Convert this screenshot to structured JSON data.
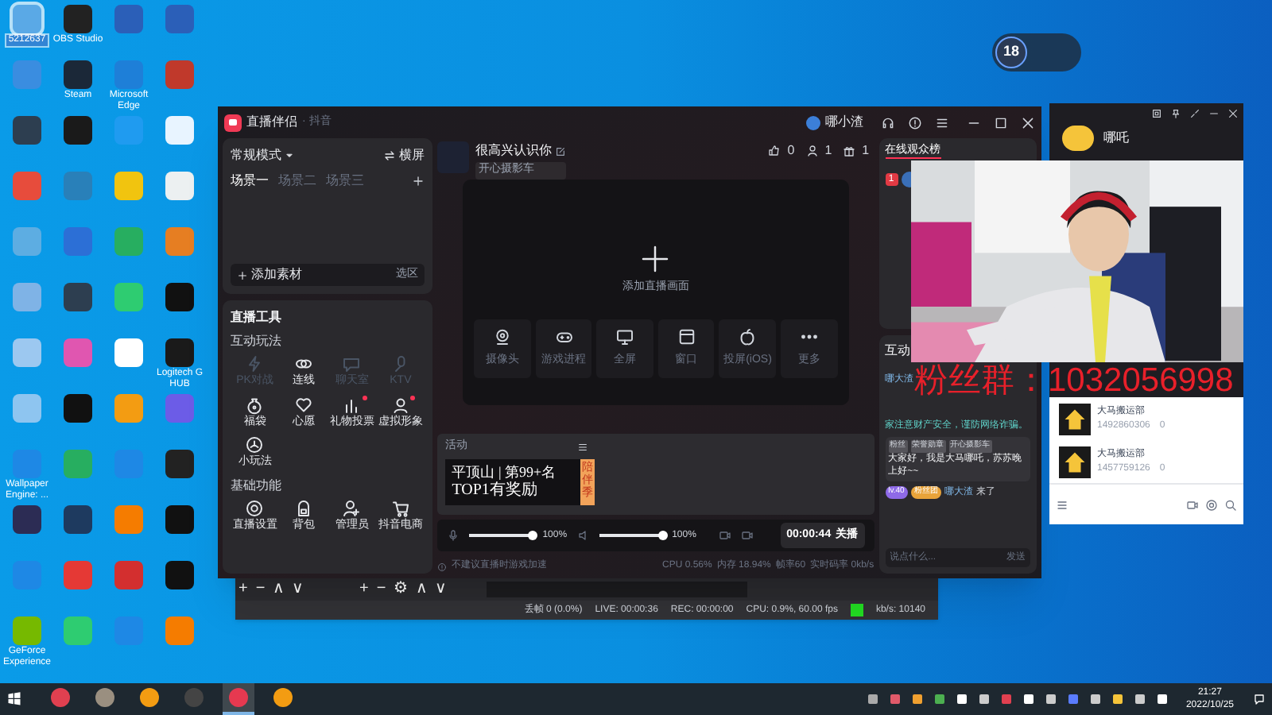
{
  "desktop_icons": [
    {
      "label": "5212637",
      "color": "#5aa9e6",
      "selected": true
    },
    {
      "label": "OBS Studio",
      "color": "#222222",
      "selected": false
    },
    {
      "color": "#2b5fb8",
      "selected": false
    },
    {
      "color": "#2b5fb8",
      "selected": false
    },
    {
      "color": "#3a8de0",
      "selected": false
    },
    {
      "label": "Steam",
      "color": "#1b2838",
      "selected": false
    },
    {
      "label": "Microsoft Edge",
      "color": "#1e7fd8",
      "selected": false
    },
    {
      "color": "#c0392b",
      "selected": false
    },
    {
      "color": "#2d3e50",
      "selected": false
    },
    {
      "color": "#1a1a1a",
      "selected": false
    },
    {
      "color": "#1f9bf0",
      "selected": false
    },
    {
      "color": "#e8f4ff",
      "selected": false
    },
    {
      "color": "#e74c3c",
      "selected": false
    },
    {
      "color": "#2980b9",
      "selected": false
    },
    {
      "color": "#f1c40f",
      "selected": false
    },
    {
      "color": "#ecf0f1",
      "selected": false
    },
    {
      "color": "#5dade2",
      "selected": false
    },
    {
      "color": "#2c6fd6",
      "selected": false
    },
    {
      "color": "#27ae60",
      "selected": false
    },
    {
      "color": "#e67e22",
      "selected": false
    },
    {
      "color": "#7fb3e6",
      "selected": false
    },
    {
      "color": "#2d3e50",
      "selected": false
    },
    {
      "color": "#2ecc71",
      "selected": false
    },
    {
      "color": "#111111",
      "selected": false
    },
    {
      "color": "#9cc8f0",
      "selected": false
    },
    {
      "color": "#e056b0",
      "selected": false
    },
    {
      "color": "#ffffff",
      "selected": false
    },
    {
      "label": "Logitech G HUB",
      "color": "#1a1a1a",
      "selected": false
    },
    {
      "color": "#8ec5f0",
      "selected": false
    },
    {
      "color": "#111111",
      "selected": false
    },
    {
      "color": "#f39c12",
      "selected": false
    },
    {
      "color": "#6c5ce7",
      "selected": false
    },
    {
      "label": "Wallpaper Engine: ...",
      "color": "#1e88e5",
      "selected": false
    },
    {
      "color": "#27ae60",
      "selected": false
    },
    {
      "color": "#1e88e5",
      "selected": false
    },
    {
      "color": "#222222",
      "selected": false
    },
    {
      "color": "#2c2c54",
      "selected": false
    },
    {
      "color": "#1e3a5f",
      "selected": false
    },
    {
      "color": "#f57c00",
      "selected": false
    },
    {
      "color": "#111111",
      "selected": false
    },
    {
      "color": "#1e88e5",
      "selected": false
    },
    {
      "color": "#e53935",
      "selected": false
    },
    {
      "color": "#d32f2f",
      "selected": false
    },
    {
      "color": "#111111",
      "selected": false
    },
    {
      "label": "GeForce Experience",
      "color": "#76b900",
      "selected": false
    },
    {
      "color": "#2ecc71",
      "selected": false
    },
    {
      "color": "#1e88e5",
      "selected": false
    },
    {
      "color": "#f57c00",
      "selected": false
    }
  ],
  "net_widget": {
    "value": "18"
  },
  "obs_window": {
    "toolbar_left": [
      "+",
      "−",
      "∧",
      "∨"
    ],
    "toolbar_right": [
      "+",
      "−",
      "⚙",
      "∧",
      "∨"
    ],
    "status": [
      "丢帧 0 (0.0%)",
      "LIVE: 00:00:36",
      "REC: 00:00:00",
      "CPU: 0.9%, 60.00 fps"
    ],
    "bitrate": "kb/s: 10140"
  },
  "app": {
    "title": "直播伴侣",
    "platform": "· 抖音",
    "user": "哪小渣",
    "mode": "常规模式",
    "orientation": "横屏",
    "scenes": [
      {
        "label": "场景一",
        "selected": true
      },
      {
        "label": "场景二",
        "selected": false
      },
      {
        "label": "场景三",
        "selected": false
      }
    ],
    "add_source": "添加素材",
    "select_area": "选区",
    "tools_title": "直播工具",
    "tool_groups": [
      {
        "title": "互动玩法",
        "items": [
          {
            "label": "PK对战",
            "disabled": true,
            "dot": false
          },
          {
            "label": "连线",
            "disabled": false,
            "dot": false
          },
          {
            "label": "聊天室",
            "disabled": true,
            "dot": false
          },
          {
            "label": "KTV",
            "disabled": true,
            "dot": false
          },
          {
            "label": "福袋",
            "disabled": false,
            "dot": false
          },
          {
            "label": "心愿",
            "disabled": false,
            "dot": false
          },
          {
            "label": "礼物投票",
            "disabled": false,
            "dot": true
          },
          {
            "label": "虚拟形象",
            "disabled": false,
            "dot": true
          },
          {
            "label": "小玩法",
            "disabled": false,
            "dot": false
          }
        ]
      },
      {
        "title": "基础功能",
        "items": [
          {
            "label": "直播设置",
            "disabled": false,
            "dot": false
          },
          {
            "label": "背包",
            "disabled": false,
            "dot": false
          },
          {
            "label": "管理员",
            "disabled": false,
            "dot": false
          },
          {
            "label": "抖音电商",
            "disabled": false,
            "dot": false
          }
        ]
      }
    ],
    "room": {
      "title": "很高兴认识你",
      "subtitle": "开心摄影车",
      "likes": "0",
      "viewers": "1",
      "gifts": "1"
    },
    "preview": {
      "prompt": "添加直播画面",
      "sources": [
        {
          "label": "摄像头"
        },
        {
          "label": "游戏进程"
        },
        {
          "label": "全屏"
        },
        {
          "label": "窗口"
        },
        {
          "label": "投屏(iOS)"
        },
        {
          "label": "更多"
        }
      ]
    },
    "activity": {
      "title": "活动",
      "rank_line": "平顶山 | 第99+名",
      "reward": "TOP1有奖励",
      "tag": "陪伴季"
    },
    "audio": [
      {
        "kind": "mic",
        "level": 1,
        "reading": "100%"
      },
      {
        "kind": "speaker",
        "level": 1,
        "reading": "100%"
      }
    ],
    "timer": "00:00:44",
    "stop": "关播",
    "hint": "不建议直播时游戏加速",
    "stats": [
      "CPU 0.56%",
      "内存 18.94%",
      "帧率60",
      "实时码率 0kb/s"
    ],
    "viewers_tab": "在线观众榜",
    "rank": "1",
    "messages_title": "互动",
    "sender": "哪大渣",
    "notice": "家注意财产安全，谨防网络诈骗。",
    "chat": {
      "badges": [
        "粉丝",
        "荣誉勋章",
        "开心摄影车"
      ],
      "text": "大家好，我是大马哪吒，苏苏晚上好~~"
    },
    "join": {
      "badges": [
        "lv.40",
        "粉丝团"
      ],
      "user": "哪大渣",
      "text": "来了"
    },
    "input": {
      "placeholder": "说点什么..."
    },
    "send": "发送"
  },
  "companion": {
    "name": "哪吒",
    "members": [
      {
        "name": "大马搬运部",
        "id": "1492860306",
        "count": "0"
      },
      {
        "name": "大马搬运部",
        "id": "1457759126",
        "count": "0"
      }
    ]
  },
  "overlay_text": "粉丝群：1032056998",
  "taskbar": {
    "apps": [
      {
        "color": "#e04050",
        "active": false
      },
      {
        "color": "#9a8f80",
        "active": false
      },
      {
        "color": "#f39c12",
        "active": false
      },
      {
        "color": "#444444",
        "active": false
      },
      {
        "color": "#e63950",
        "active": true
      },
      {
        "color": "#f39c12",
        "active": false
      }
    ],
    "time": "21:27",
    "date": "2022/10/25"
  }
}
